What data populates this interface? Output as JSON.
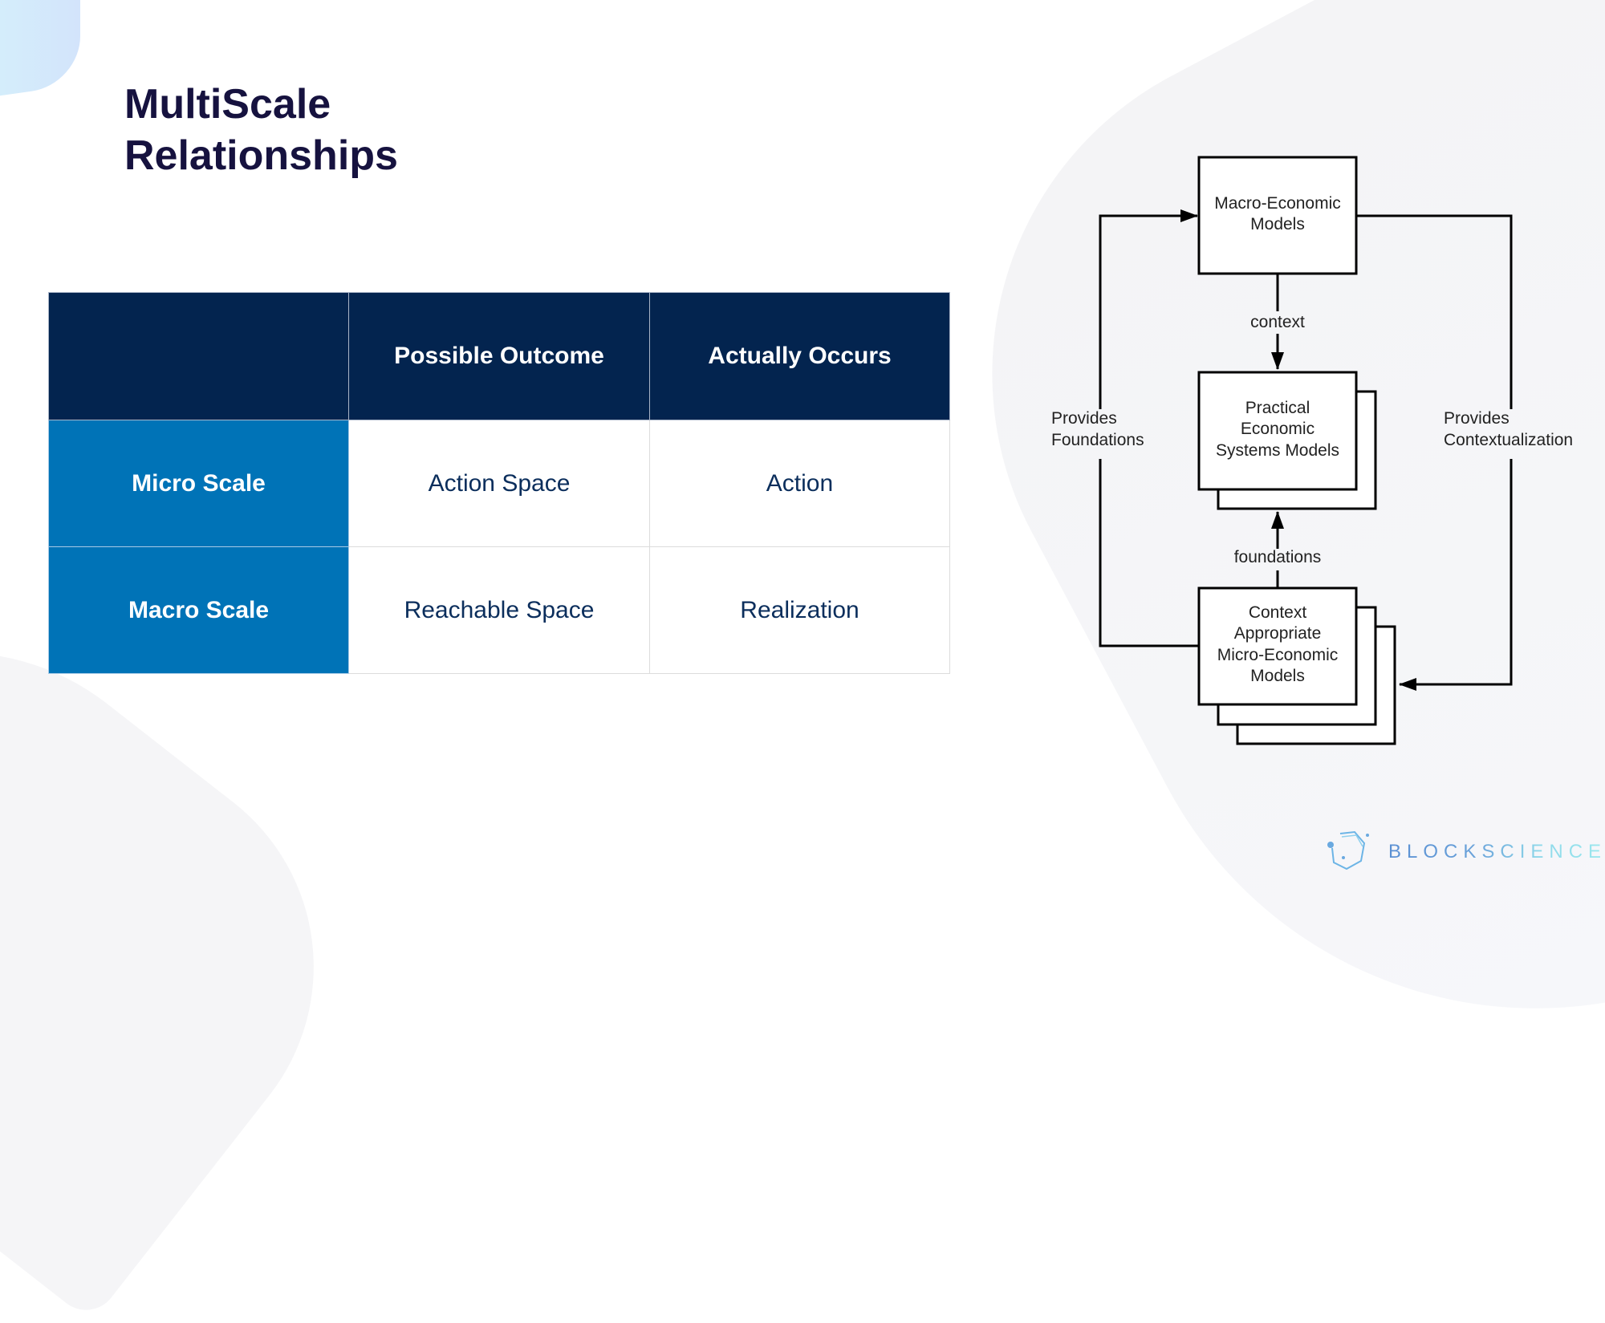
{
  "slide": {
    "title_lines": [
      "MultiScale",
      "Relationships"
    ]
  },
  "table": {
    "columns": [
      "",
      "Possible Outcome",
      "Actually Occurs"
    ],
    "rows": [
      {
        "label": "Micro Scale",
        "cells": [
          "Action Space",
          "Action"
        ]
      },
      {
        "label": "Macro Scale",
        "cells": [
          "Reachable Space",
          "Realization"
        ]
      }
    ]
  },
  "diagram": {
    "nodes": {
      "macro": [
        "Macro-Economic",
        "Models"
      ],
      "practical": [
        "Practical",
        "Economic",
        "Systems Models"
      ],
      "micro": [
        "Context",
        "Appropriate",
        "Micro-Economic",
        "Models"
      ]
    },
    "edges": {
      "context": "context",
      "foundations": "foundations",
      "provides_foundations": [
        "Provides",
        "Foundations"
      ],
      "provides_contextualization": [
        "Provides",
        "Contextualization"
      ]
    }
  },
  "brand": {
    "name": "BLOCKSCIENCE",
    "colors": {
      "primary": "#5a8fd3",
      "accent": "#9ce8ee"
    }
  },
  "colors": {
    "title": "#16123f",
    "header_bg": "#03244f",
    "row_header_bg": "#0073b7",
    "cell_text": "#0b2e5c"
  }
}
